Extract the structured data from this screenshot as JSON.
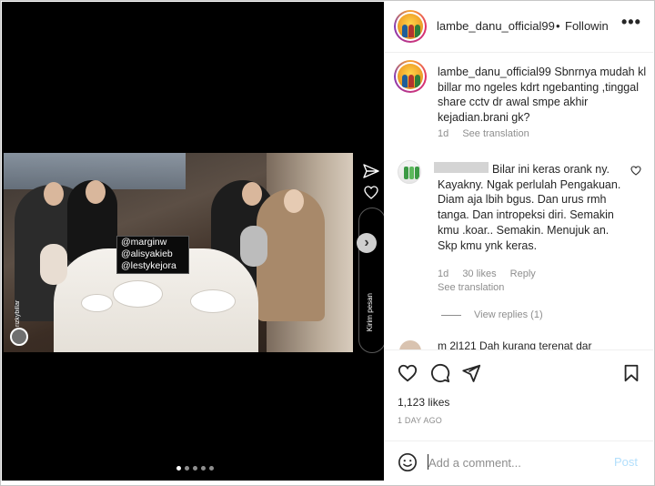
{
  "media": {
    "tag_lines": [
      "@marginw",
      "@alisyakieb",
      "@lestykejora"
    ],
    "story_handle": "rizkybillar",
    "kirim_label": "Kirim pesan",
    "next_glyph": "›",
    "carousel_dots": 5,
    "carousel_active_index": 0
  },
  "header": {
    "username": "lambe_danu_official99",
    "separator": "•",
    "follow_label": "Followin",
    "more_glyph": "•••"
  },
  "caption": {
    "username": "lambe_danu_official99",
    "text": "Sbnrnya mudah kl billar mo ngeles kdrt ngebanting ,tinggal share cctv dr awal smpe akhir kejadian.brani gk?",
    "time": "1d",
    "see_translation": "See translation"
  },
  "comment": {
    "text": "Bilar ini keras orank ny. Kayakny. Ngak perlulah Pengakuan. Diam aja lbih bgus. Dan urus rmh tanga. Dan intropeksi diri. Semakin kmu .koar.. Semakin. Menujuk an. Skp kmu ynk keras.",
    "time": "1d",
    "likes": "30 likes",
    "reply_label": "Reply",
    "see_translation": "See translation",
    "view_replies": "View replies (1)",
    "next_comment_peek": "m 2l121 Dah kurang terenat dar"
  },
  "actions": {
    "icons": [
      "heart-icon",
      "comment-icon",
      "share-icon",
      "bookmark-icon"
    ]
  },
  "stats": {
    "likes": "1,123 likes",
    "time_ago": "1 DAY AGO"
  },
  "composer": {
    "placeholder": "Add a comment...",
    "post_label": "Post",
    "post_color": "#b2dffc"
  },
  "colors": {
    "text": "#262626",
    "muted": "#8e8e8e",
    "divider": "#efefef"
  }
}
